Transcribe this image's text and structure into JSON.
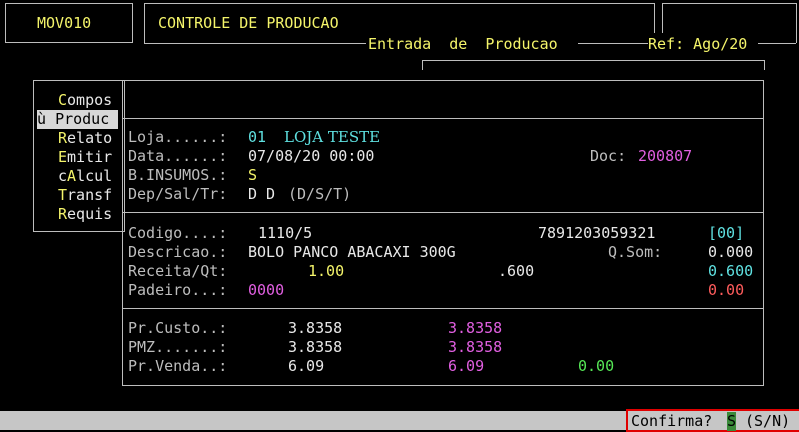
{
  "header": {
    "program_code": "MOV010",
    "title": "CONTROLE DE PRODUCAO",
    "subtitle": "Entrada  de  Producao",
    "ref": "Ref: Ago/20"
  },
  "menu": {
    "items": [
      {
        "hotkey": "C",
        "rest": "ompos",
        "selected": false
      },
      {
        "hotkey": "ù ",
        "rest": "Produc",
        "selected": true
      },
      {
        "hotkey": "R",
        "rest": "elato",
        "selected": false
      },
      {
        "hotkey": "E",
        "rest": "mitir",
        "selected": false
      },
      {
        "hotkey": "c",
        "rest": "A",
        "rest2": "lcul",
        "selected": false
      },
      {
        "hotkey": "T",
        "rest": "ransf",
        "selected": false
      },
      {
        "hotkey": "R",
        "rest": "equis",
        "selected": false
      }
    ]
  },
  "store": {
    "loja_label": "Loja......:",
    "loja_code": "01",
    "loja_name": "LOJA TESTE",
    "data_label": "Data......:",
    "data_value": "07/08/20 00:00",
    "doc_label": "Doc:",
    "doc_value": "200807",
    "insumos_label": "B.INSUMOS.:",
    "insumos_value": "S",
    "dep_label": "Dep/Sal/Tr:",
    "dep_value": "D D",
    "dep_hint": "(D/S/T)"
  },
  "product": {
    "codigo_label": "Codigo....:",
    "codigo_value": "1110/5",
    "barcode": "7891203059321",
    "bracket_value": "[00]",
    "descricao_label": "Descricao.:",
    "descricao_value": "BOLO PANCO ABACAXI 300G",
    "qsom_label": "Q.Som:",
    "qsom_value": "0.000",
    "receita_label": "Receita/Qt:",
    "receita_value": "1.00",
    "receita_qty": ".600",
    "receita_right": "0.600",
    "padeiro_label": "Padeiro...:",
    "padeiro_value": "0000",
    "padeiro_right": "0.00"
  },
  "prices": {
    "custo_label": "Pr.Custo..:",
    "custo_value": "3.8358",
    "custo_value2": "3.8358",
    "pmz_label": "PMZ.......:",
    "pmz_value": "3.8358",
    "pmz_value2": "3.8358",
    "venda_label": "Pr.Venda..:",
    "venda_value": "6.09",
    "venda_value2": "6.09",
    "venda_value3": "0.00"
  },
  "status": {
    "confirm_label": "Confirma?",
    "confirm_value": "S",
    "confirm_options": "(S/N)"
  }
}
